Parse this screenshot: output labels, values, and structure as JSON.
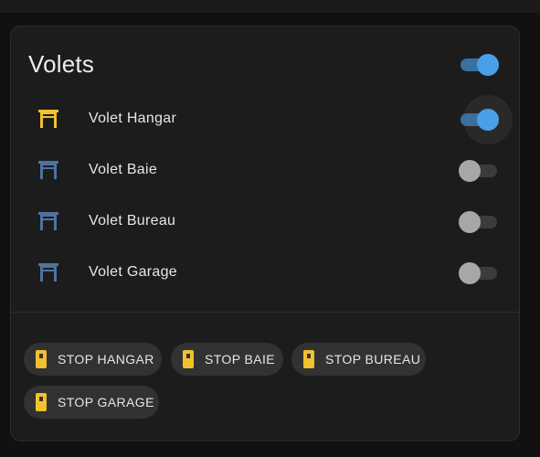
{
  "card": {
    "title": "Volets",
    "master_toggle_on": true
  },
  "rows": [
    {
      "label": "Volet Hangar",
      "on": true,
      "icon": "shutter-icon",
      "icon_color": "#f2c12e"
    },
    {
      "label": "Volet Baie",
      "on": false,
      "icon": "shutter-icon",
      "icon_color": "#4f73a0"
    },
    {
      "label": "Volet Bureau",
      "on": false,
      "icon": "shutter-icon",
      "icon_color": "#4f73a0"
    },
    {
      "label": "Volet Garage",
      "on": false,
      "icon": "shutter-icon",
      "icon_color": "#4f73a0"
    }
  ],
  "chips": [
    {
      "label": "STOP HANGAR",
      "icon": "stop-remote-icon"
    },
    {
      "label": "STOP BAIE",
      "icon": "stop-remote-icon"
    },
    {
      "label": "STOP BUREAU",
      "icon": "stop-remote-icon"
    },
    {
      "label": "STOP GARAGE",
      "icon": "stop-remote-icon"
    }
  ],
  "colors": {
    "accent": "#4aa0e8",
    "active_icon": "#f2c12e",
    "inactive_icon": "#4f73a0",
    "chip_icon": "#f2c12e"
  }
}
